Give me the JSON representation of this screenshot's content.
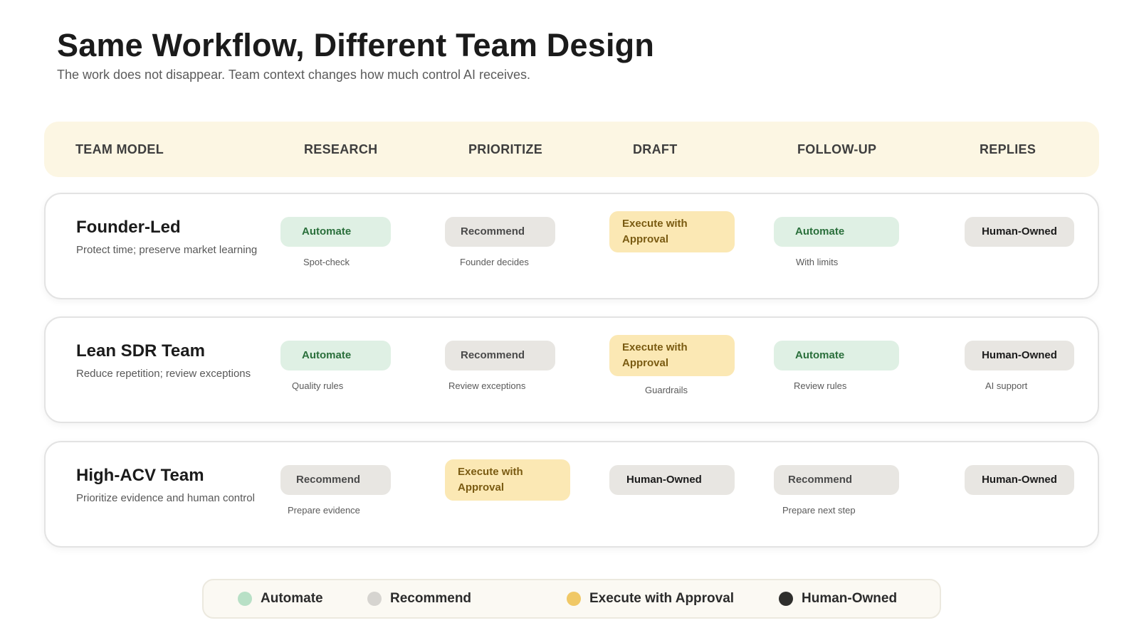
{
  "title": "Same Workflow, Different Team Design",
  "subtitle": "The work does not disappear. Team context changes how much control AI receives.",
  "headers": [
    "TEAM MODEL",
    "RESEARCH",
    "PRIORITIZE",
    "DRAFT",
    "FOLLOW-UP",
    "REPLIES"
  ],
  "colors": {
    "automate": "#dff0e4",
    "recommend": "#e8e6e2",
    "execute": "#fbe8b4",
    "human": "#e8e6e2",
    "legend_automate": "#b8e0c6",
    "legend_recommend": "#d6d4d0",
    "legend_execute": "#f0c866",
    "legend_human": "#2f2f2d"
  },
  "rows": [
    {
      "name": "Founder-Led",
      "desc": "Protect time; preserve market learning",
      "cells": [
        {
          "status": "Automate",
          "note": "Spot-check"
        },
        {
          "status": "Recommend",
          "note": "Founder decides"
        },
        {
          "status": "Execute with Approval",
          "status_line1": "Execute with",
          "status_line2": "Approval",
          "note": ""
        },
        {
          "status": "Automate",
          "note": "With limits"
        },
        {
          "status": "Human-Owned",
          "note": ""
        }
      ]
    },
    {
      "name": "Lean SDR Team",
      "desc": "Reduce repetition; review exceptions",
      "cells": [
        {
          "status": "Automate",
          "note": "Quality rules"
        },
        {
          "status": "Recommend",
          "note": "Review exceptions"
        },
        {
          "status": "Execute with Approval",
          "status_line1": "Execute with",
          "status_line2": "Approval",
          "note": "Guardrails"
        },
        {
          "status": "Automate",
          "note": "Review rules"
        },
        {
          "status": "Human-Owned",
          "note": "AI support"
        }
      ]
    },
    {
      "name": "High-ACV Team",
      "desc": "Prioritize evidence and human control",
      "cells": [
        {
          "status": "Recommend",
          "note": "Prepare evidence"
        },
        {
          "status": "Execute with Approval",
          "status_line1": "Execute with",
          "status_line2": "Approval",
          "note": ""
        },
        {
          "status": "Human-Owned",
          "note": ""
        },
        {
          "status": "Recommend",
          "note": "Prepare next step"
        },
        {
          "status": "Human-Owned",
          "note": ""
        }
      ]
    }
  ],
  "legend": [
    "Automate",
    "Recommend",
    "Execute with Approval",
    "Human-Owned"
  ]
}
